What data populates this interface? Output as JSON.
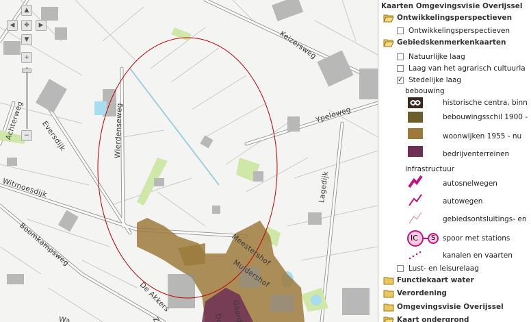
{
  "map": {
    "roads": [
      {
        "name": "Keizersweg"
      },
      {
        "name": "Ypeloweg"
      },
      {
        "name": "Lagedijk"
      },
      {
        "name": "Wierdenseweg"
      },
      {
        "name": "Eversdijk"
      },
      {
        "name": "Achterweg"
      },
      {
        "name": "Witmoesdijk"
      },
      {
        "name": "Boomkampsweg"
      },
      {
        "name": "Meestershof"
      },
      {
        "name": "Muldershof"
      },
      {
        "name": "De Akkers"
      },
      {
        "name": "Gaard"
      },
      {
        "name": "Do"
      },
      {
        "name": "Wa"
      },
      {
        "name": "Z"
      }
    ],
    "nav": {
      "up": "▲",
      "down": "▼",
      "left": "◀",
      "right": "▶",
      "center": "✥",
      "zoom_in": "+",
      "zoom_out": "−"
    }
  },
  "panel": {
    "title": "Kaarten Omgevingsvisie Overijssel",
    "groups": [
      {
        "label": "Ontwikkelingsperspectieven",
        "child": "Ontwikkelingsperspectieven"
      },
      {
        "label": "Gebiedskenmerkenkaarten"
      }
    ],
    "layers": [
      {
        "label": "Natuurlijke laag",
        "checked": false
      },
      {
        "label": "Laag van het agrarisch cultuurla",
        "checked": false
      },
      {
        "label": "Stedelijke laag",
        "checked": true
      }
    ],
    "legend": {
      "bebouwing_label": "bebouwing",
      "bebouwing": [
        {
          "label": "historische centra, binn",
          "color": "#3a2a1e"
        },
        {
          "label": "bebouwingsschil 1900 -",
          "color": "#6b5e2a"
        },
        {
          "label": "woonwijken 1955 - nu",
          "color": "#9c7a3c"
        },
        {
          "label": "bedrijventerreinen",
          "color": "#6e2f55"
        }
      ],
      "infra_label": "infrastructuur",
      "infra": [
        {
          "label": "autosnelwegen",
          "color": "#c0157e"
        },
        {
          "label": "autowegen",
          "color": "#c0157e"
        },
        {
          "label": "gebiedsontsluitings- en",
          "color": "#d778b4"
        },
        {
          "label": "spoor met stations",
          "color": "#c0157e",
          "station_ic": "IC",
          "station_s": "S"
        },
        {
          "label": "kanalen en vaarten",
          "color": "#c0157e"
        }
      ]
    },
    "after": [
      {
        "label": "Lust- en leisurelaag",
        "checked": false
      }
    ],
    "bottom_groups": [
      {
        "label": "Functiekaart water"
      },
      {
        "label": "Verordening"
      },
      {
        "label": "Omgevingsvisie Overijssel"
      },
      {
        "label": "Kaart ondergrond"
      }
    ]
  }
}
